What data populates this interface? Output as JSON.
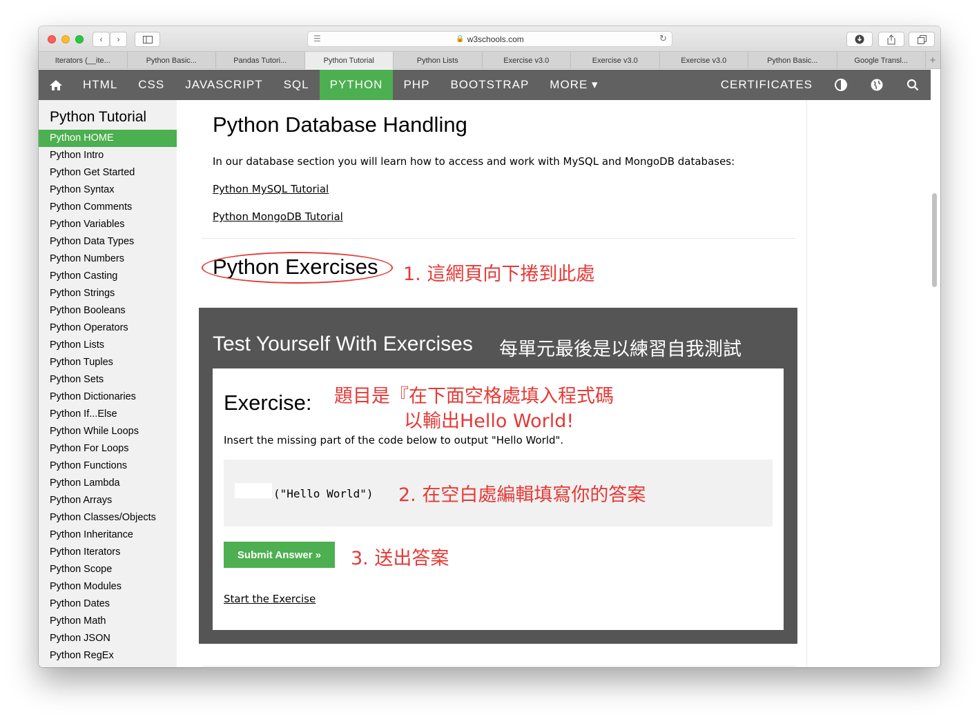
{
  "browser": {
    "address": "w3schools.com",
    "tabs": [
      {
        "label": "Iterators (__ite..."
      },
      {
        "label": "Python Basic..."
      },
      {
        "label": "Pandas Tutori..."
      },
      {
        "label": "Python Tutorial"
      },
      {
        "label": "Python Lists"
      },
      {
        "label": "Exercise v3.0"
      },
      {
        "label": "Exercise v3.0"
      },
      {
        "label": "Exercise v3.0"
      },
      {
        "label": "Python Basic..."
      },
      {
        "label": "Google Transl..."
      }
    ],
    "new_tab_label": "+"
  },
  "nav": {
    "items": [
      "HTML",
      "CSS",
      "JAVASCRIPT",
      "SQL",
      "PYTHON",
      "PHP",
      "BOOTSTRAP",
      "MORE ▾"
    ],
    "certificates": "CERTIFICATES",
    "active_color": "#4CAF50",
    "bar_color": "#616161"
  },
  "sidebar": {
    "title": "Python Tutorial",
    "items": [
      "Python HOME",
      "Python Intro",
      "Python Get Started",
      "Python Syntax",
      "Python Comments",
      "Python Variables",
      "Python Data Types",
      "Python Numbers",
      "Python Casting",
      "Python Strings",
      "Python Booleans",
      "Python Operators",
      "Python Lists",
      "Python Tuples",
      "Python Sets",
      "Python Dictionaries",
      "Python If...Else",
      "Python While Loops",
      "Python For Loops",
      "Python Functions",
      "Python Lambda",
      "Python Arrays",
      "Python Classes/Objects",
      "Python Inheritance",
      "Python Iterators",
      "Python Scope",
      "Python Modules",
      "Python Dates",
      "Python Math",
      "Python JSON",
      "Python RegEx"
    ]
  },
  "main": {
    "db_title": "Python Database Handling",
    "db_desc": "In our database section you will learn how to access and work with MySQL and MongoDB databases:",
    "link_mysql": "Python MySQL Tutorial",
    "link_mongo": "Python MongoDB Tutorial",
    "exercises_title": "Python Exercises",
    "test_title": "Test Yourself With Exercises",
    "exercise_head": "Exercise:",
    "exercise_desc": "Insert the missing part of the code below to output \"Hello World\".",
    "code_input_value": "",
    "code_text": "(\"Hello World\")",
    "submit_label": "Submit Answer »",
    "start_link": "Start the Exercise"
  },
  "annotations": {
    "a1": "1. 這網頁向下捲到此處",
    "test_cn": "每單元最後是以練習自我測試",
    "q_line1": "題目是『在下面空格處填入程式碼",
    "q_line2": "以輸出Hello World!",
    "a2": "2. 在空白處編輯填寫你的答案",
    "a3": "3. 送出答案",
    "color": "#e53935"
  }
}
